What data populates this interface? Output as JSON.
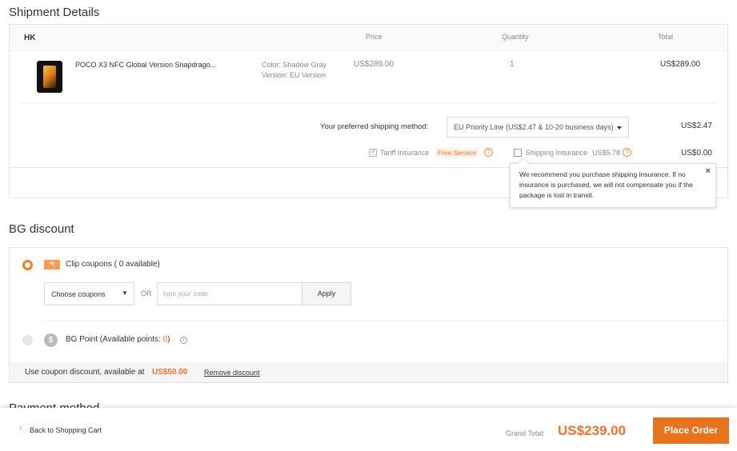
{
  "shipment": {
    "title": "Shipment Details",
    "warehouse": "HK",
    "col_price": "Price",
    "col_quantity": "Quantity",
    "col_total": "Total",
    "item": {
      "name": "POCO X3 NFC Global Version Snapdrago...",
      "color": "Color: Shadow Gray",
      "version": "Version: EU Version",
      "price": "US$289.00",
      "quantity": "1",
      "total": "US$289.00"
    },
    "shipping_label": "Your preferred shipping method:",
    "shipping_method": "EU Priority Line (US$2.47 & 10-20 business days)",
    "shipping_cost": "US$2.47",
    "tariff_label": "Tariff Insurance",
    "tariff_badge": "Free Service",
    "shipping_insurance_label": "Shipping Insurance",
    "shipping_insurance_price": "US$5.78",
    "insurance_total": "US$0.00",
    "tooltip_text": "We recommend you purchase shipping insurance. If no insurance is purchased, we will not compensate you if the package is lost in transit.",
    "tooltip_close": "×"
  },
  "discount": {
    "title": "BG discount",
    "clip_coupons_label": "Clip coupons ( 0 available)",
    "coupon_icon_text": "%",
    "choose_coupons": "Choose coupons",
    "or_text": "OR",
    "code_placeholder": "type your code.",
    "apply_label": "Apply",
    "bg_point_prefix": "BG Point (Available points: ",
    "bg_point_value": "0",
    "bg_point_suffix": ")",
    "point_icon_text": "$",
    "info_icon_text": "i",
    "help_icon_text": "?",
    "use_coupon_text": "Use coupon discount, available at",
    "use_coupon_amount": "US$50.00",
    "remove_discount": "Remove discount"
  },
  "payment": {
    "title_partial": "Payment method"
  },
  "footer": {
    "back_label": "Back to Shopping Cart",
    "back_icon": "‹",
    "grand_total_label": "Grand Total:",
    "grand_total_value": "US$239.00",
    "place_order": "Place Order"
  },
  "colors": {
    "accent": "#ff6e26",
    "button": "#e8731c"
  }
}
